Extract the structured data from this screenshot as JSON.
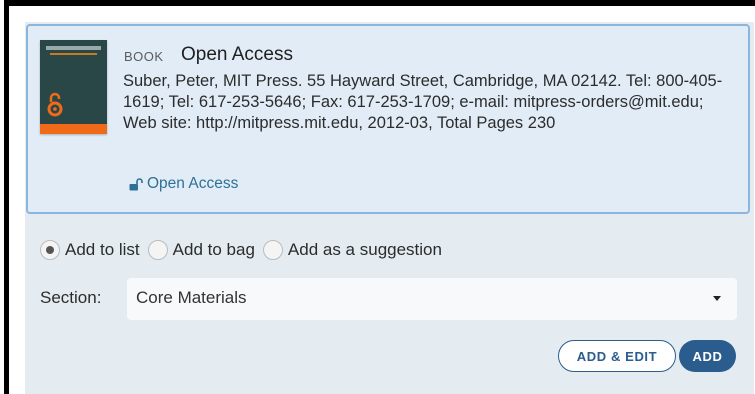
{
  "item": {
    "type": "BOOK",
    "title": "Open Access",
    "citation": "Suber, Peter,  MIT Press. 55 Hayward Street, Cambridge, MA 02142. Tel: 800-405-1619; Tel: 617-253-5646; Fax: 617-253-1709; e-mail: mitpress-orders@mit.edu; Web site: http://mitpress.mit.edu, 2012-03, Total Pages 230",
    "access_link": "Open Access",
    "cover_icon": "open-access-icon",
    "access_icon": "unlocked-padlock-icon"
  },
  "options": {
    "selected": "Add to list",
    "items": [
      {
        "label": "Add to list",
        "checked": true
      },
      {
        "label": "Add to bag",
        "checked": false
      },
      {
        "label": "Add as a suggestion",
        "checked": false
      }
    ]
  },
  "section": {
    "label": "Section:",
    "value": "Core Materials"
  },
  "buttons": {
    "add_edit": "ADD & EDIT",
    "add": "ADD"
  },
  "colors": {
    "panel_background": "#e4ecf1",
    "card_border": "#8bb6de",
    "link": "#2d7196",
    "button_primary": "#2a5d8d",
    "cover_band": "#f06a1a"
  }
}
